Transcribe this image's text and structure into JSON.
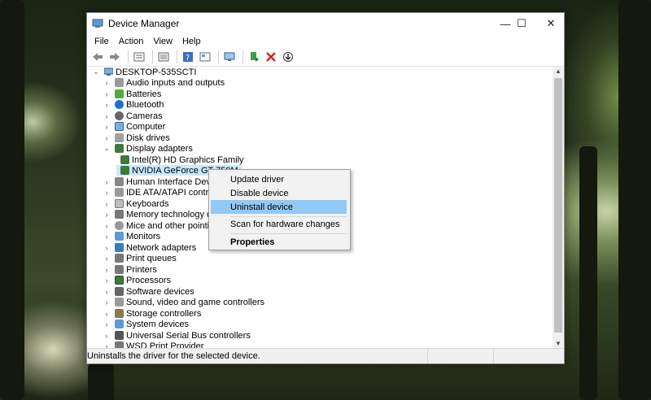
{
  "window": {
    "title": "Device Manager",
    "controls": {
      "minimize": "—",
      "maximize": "☐",
      "close": "✕"
    }
  },
  "menu": [
    "File",
    "Action",
    "View",
    "Help"
  ],
  "tree": {
    "root": "DESKTOP-535SCTI",
    "items": [
      "Audio inputs and outputs",
      "Batteries",
      "Bluetooth",
      "Cameras",
      "Computer",
      "Disk drives",
      "Display adapters",
      "Intel(R) HD Graphics Family",
      "NVIDIA GeForce GT 750M",
      "Human Interface Devices",
      "IDE ATA/ATAPI controllers",
      "Keyboards",
      "Memory technology devic",
      "Mice and other pointing d",
      "Monitors",
      "Network adapters",
      "Print queues",
      "Printers",
      "Processors",
      "Software devices",
      "Sound, video and game controllers",
      "Storage controllers",
      "System devices",
      "Universal Serial Bus controllers",
      "WSD Print Provider"
    ]
  },
  "context_menu": {
    "items": [
      "Update driver",
      "Disable device",
      "Uninstall device",
      "Scan for hardware changes",
      "Properties"
    ],
    "highlighted": "Uninstall device"
  },
  "status": "Uninstalls the driver for the selected device.",
  "colors": {
    "selection": "#cce8ff",
    "menu_highlight": "#91c9f7"
  }
}
